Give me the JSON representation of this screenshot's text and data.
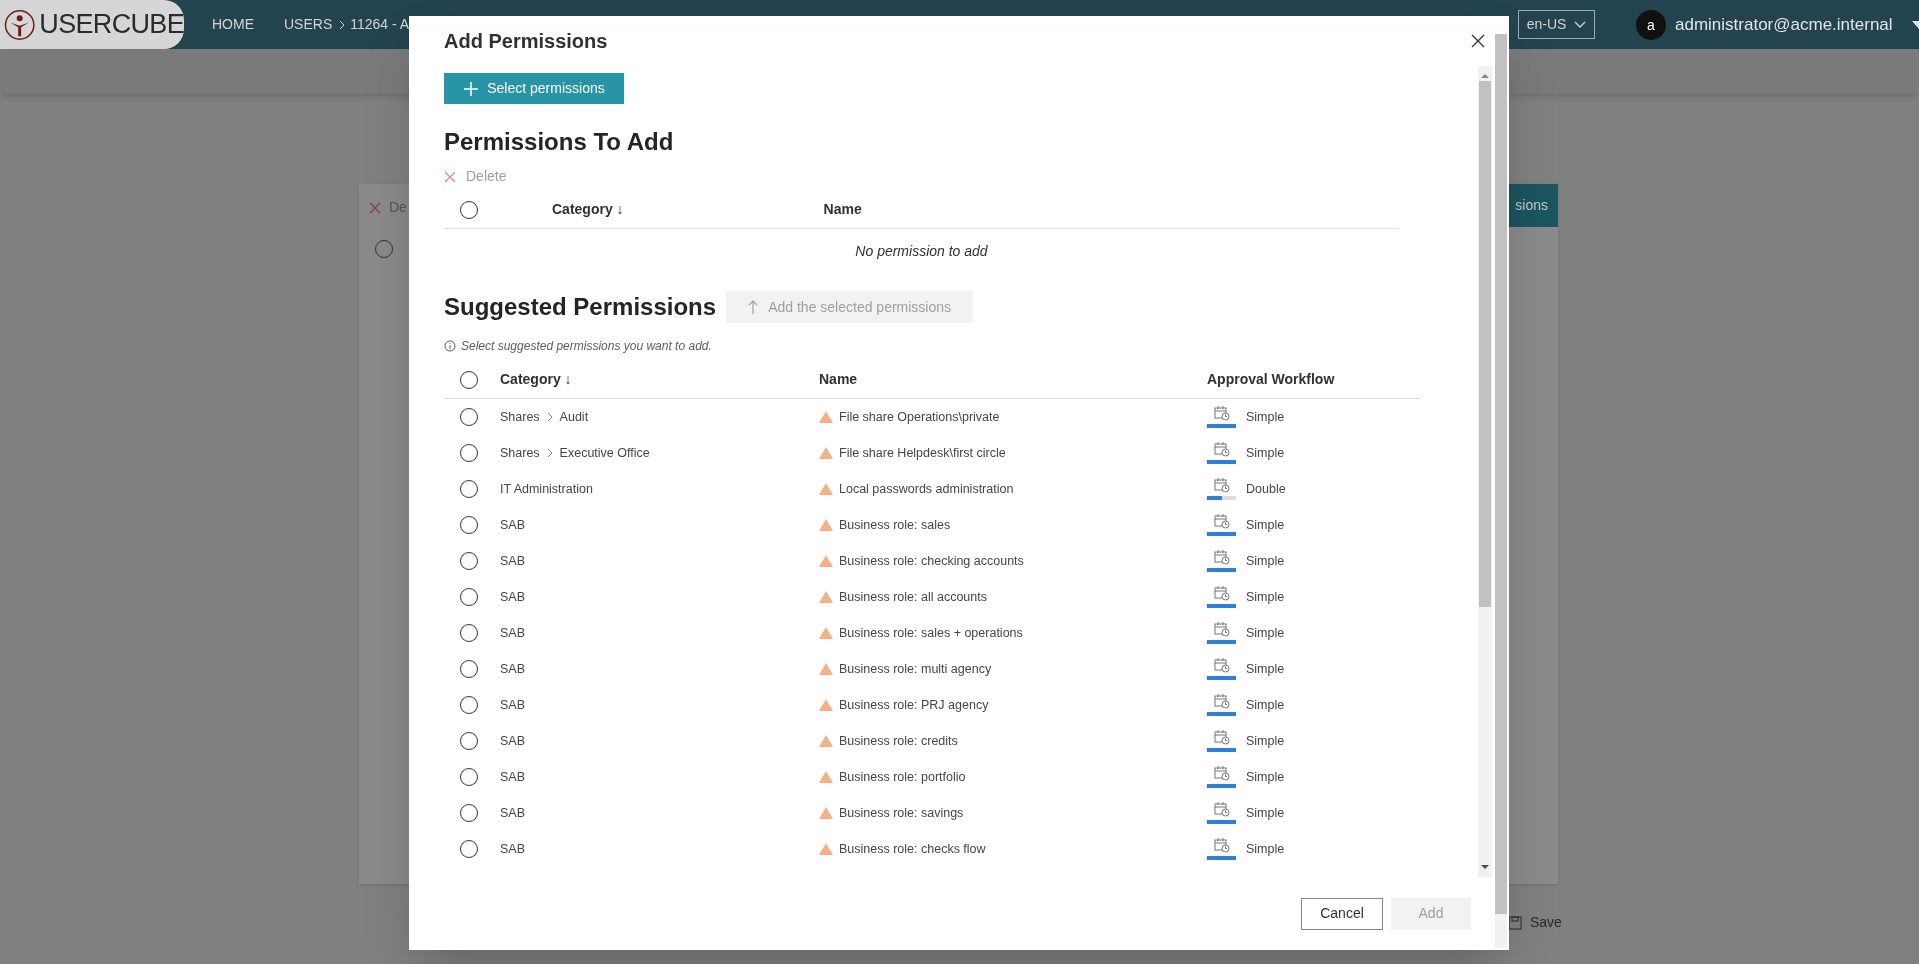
{
  "header": {
    "logo": "USERCUBE",
    "nav": [
      "HOME",
      "USERS"
    ],
    "breadcrumb_tail": "11264 - A",
    "language": "en-US",
    "avatar": "a",
    "user": "administrator@acme.internal"
  },
  "background": {
    "select_all_selected": false,
    "delete_label": "De",
    "action_button": "sions",
    "save_label": "Save"
  },
  "dialog": {
    "title": "Add Permissions",
    "select_button": "Select permissions",
    "to_add": {
      "select_all_selected": false,
      "title": "Permissions To Add",
      "delete_label": "Delete",
      "columns": [
        "Category ↓",
        "Name"
      ],
      "empty": "No permission to add"
    },
    "suggested": {
      "select_all_selected": false,
      "title": "Suggested Permissions",
      "add_button": "Add the selected permissions",
      "hint": "Select suggested permissions you want to add.",
      "columns": [
        "Category ↓",
        "Name",
        "Approval Workflow"
      ],
      "rows": [
        {
          "selected": false,
          "category": [
            "Shares",
            "Audit"
          ],
          "name": "File share Operations\\private",
          "workflow": "Simple",
          "level": 1
        },
        {
          "selected": false,
          "category": [
            "Shares",
            "Executive Office"
          ],
          "name": "File share Helpdesk\\first circle",
          "workflow": "Simple",
          "level": 1
        },
        {
          "selected": false,
          "category": [
            "IT Administration"
          ],
          "name": "Local passwords administration",
          "workflow": "Double",
          "level": 0.5
        },
        {
          "selected": false,
          "category": [
            "SAB"
          ],
          "name": "Business role: sales",
          "workflow": "Simple",
          "level": 1
        },
        {
          "selected": false,
          "category": [
            "SAB"
          ],
          "name": "Business role: checking accounts",
          "workflow": "Simple",
          "level": 1
        },
        {
          "selected": false,
          "category": [
            "SAB"
          ],
          "name": "Business role: all accounts",
          "workflow": "Simple",
          "level": 1
        },
        {
          "selected": false,
          "category": [
            "SAB"
          ],
          "name": "Business role: sales + operations",
          "workflow": "Simple",
          "level": 1
        },
        {
          "selected": false,
          "category": [
            "SAB"
          ],
          "name": "Business role: multi agency",
          "workflow": "Simple",
          "level": 1
        },
        {
          "selected": false,
          "category": [
            "SAB"
          ],
          "name": "Business role: PRJ agency",
          "workflow": "Simple",
          "level": 1
        },
        {
          "selected": false,
          "category": [
            "SAB"
          ],
          "name": "Business role: credits",
          "workflow": "Simple",
          "level": 1
        },
        {
          "selected": false,
          "category": [
            "SAB"
          ],
          "name": "Business role: portfolio",
          "workflow": "Simple",
          "level": 1
        },
        {
          "selected": false,
          "category": [
            "SAB"
          ],
          "name": "Business role: savings",
          "workflow": "Simple",
          "level": 1
        },
        {
          "selected": false,
          "category": [
            "SAB"
          ],
          "name": "Business role: checks flow",
          "workflow": "Simple",
          "level": 1
        }
      ]
    },
    "footer": {
      "cancel": "Cancel",
      "add": "Add",
      "add_disabled": true
    }
  }
}
